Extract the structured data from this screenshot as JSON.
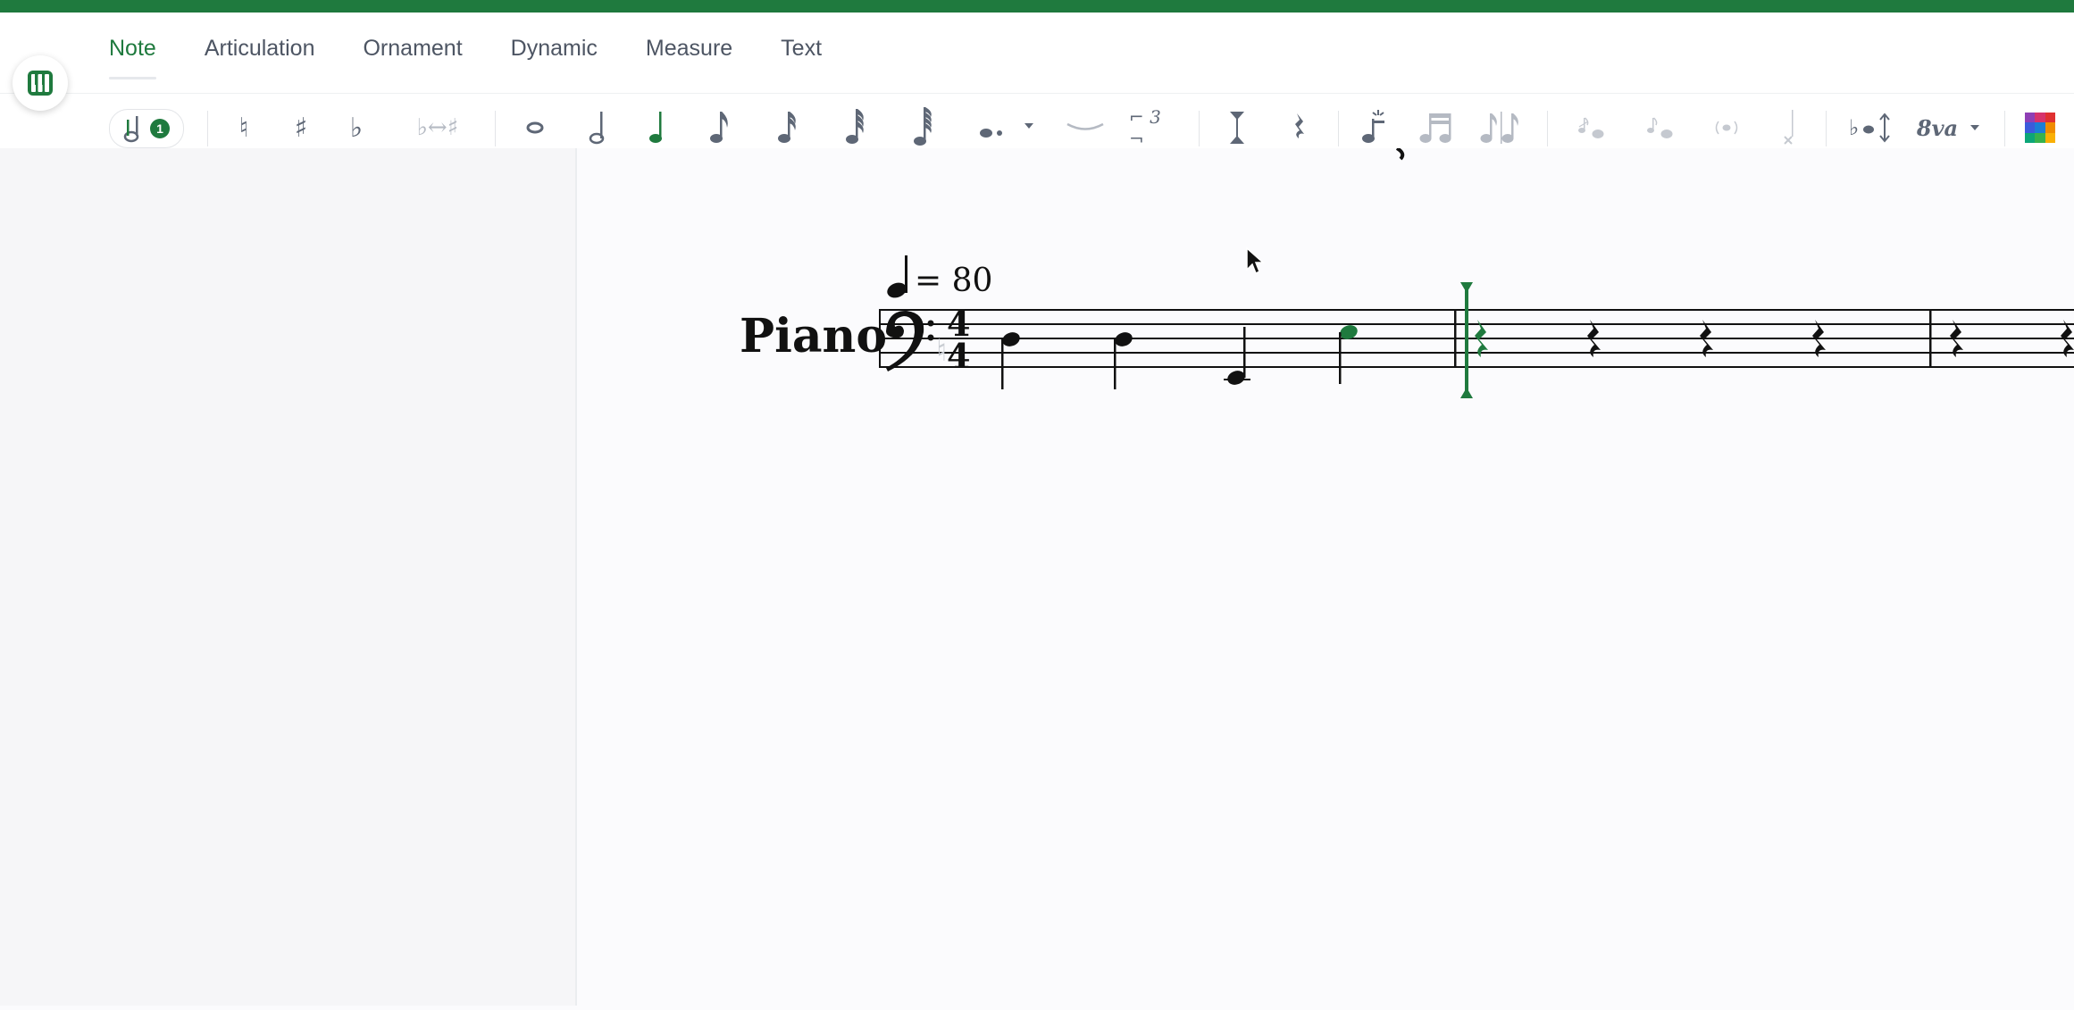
{
  "tabs": [
    {
      "label": "Note",
      "active": true
    },
    {
      "label": "Articulation",
      "active": false
    },
    {
      "label": "Ornament",
      "active": false
    },
    {
      "label": "Dynamic",
      "active": false
    },
    {
      "label": "Measure",
      "active": false
    },
    {
      "label": "Text",
      "active": false
    }
  ],
  "toolbar": {
    "voice_badge": "1",
    "natural": "♮",
    "sharp": "♯",
    "flat": "♭",
    "enharmonic": "♭↔♯",
    "tuplet": "⌐ 3 ¬",
    "ottava": "8va"
  },
  "score": {
    "tempo_value": "= 80",
    "instrument": "Piano",
    "time_top": "4",
    "time_bottom": "4"
  },
  "colors": {
    "accent": "#1f7a3e",
    "icon": "#5e6776",
    "icon_light": "#b5bac3"
  }
}
